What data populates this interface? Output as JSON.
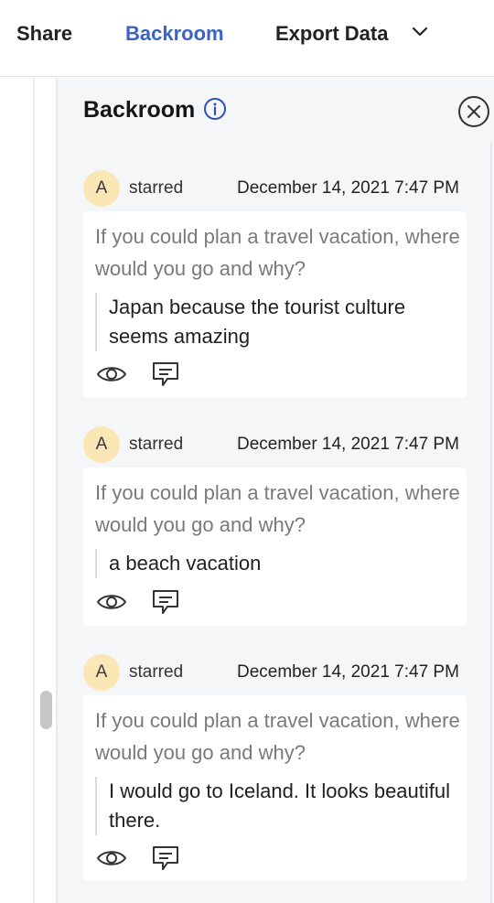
{
  "tabs": {
    "share": "Share",
    "backroom": "Backroom",
    "export": "Export Data"
  },
  "panel": {
    "title": "Backroom"
  },
  "entries": [
    {
      "avatar": "A",
      "action": "starred",
      "timestamp": "December 14, 2021 7:47 PM",
      "question": "If you could plan a travel vacation, where would you go and why?",
      "answer": "Japan because the tourist culture seems amazing"
    },
    {
      "avatar": "A",
      "action": "starred",
      "timestamp": "December 14, 2021 7:47 PM",
      "question": "If you could plan a travel vacation, where would you go and why?",
      "answer": "a beach vacation"
    },
    {
      "avatar": "A",
      "action": "starred",
      "timestamp": "December 14, 2021 7:47 PM",
      "question": "If you could plan a travel vacation, where would you go and why?",
      "answer": "I would go to Iceland. It looks beautiful there."
    }
  ],
  "colors": {
    "accent": "#3a63c8",
    "avatar_bg": "#fbe7b5",
    "panel_bg": "#f4f6f8"
  }
}
